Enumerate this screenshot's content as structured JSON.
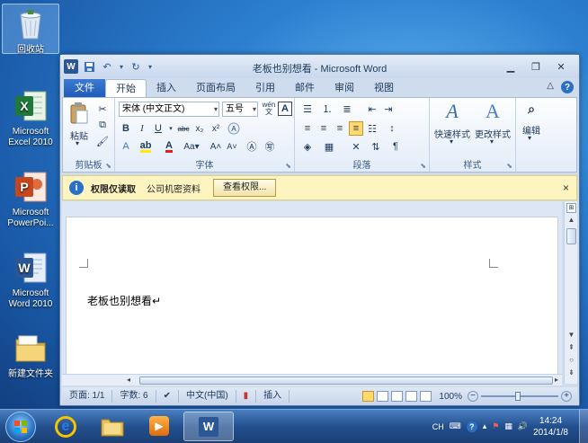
{
  "desktop": {
    "icons": [
      {
        "label": "回收站",
        "icon": "recycle-bin-icon"
      },
      {
        "label": "Microsoft Excel 2010",
        "icon": "excel-icon"
      },
      {
        "label": "Microsoft PowerPoi...",
        "icon": "powerpoint-icon"
      },
      {
        "label": "Microsoft Word 2010",
        "icon": "word-icon"
      },
      {
        "label": "新建文件夹",
        "icon": "folder-icon"
      }
    ]
  },
  "window": {
    "title": "老板也别想看 - Microsoft Word",
    "qat": {
      "logo": "W"
    },
    "tabs": [
      "文件",
      "开始",
      "插入",
      "页面布局",
      "引用",
      "邮件",
      "审阅",
      "视图"
    ],
    "active_tab": "开始",
    "ribbon": {
      "clipboard": {
        "paste_label": "粘贴",
        "group_label": "剪贴板"
      },
      "font": {
        "font_name": "宋体 (中文正文)",
        "font_size": "五号",
        "group_label": "字体",
        "wen": "wén",
        "wen_char": "文"
      },
      "paragraph": {
        "group_label": "段落"
      },
      "styles": {
        "quick_styles": "快速样式",
        "change_styles": "更改样式",
        "group_label": "样式"
      },
      "editing": {
        "label": "编辑"
      }
    },
    "message_bar": {
      "title": "权限仅读取",
      "text": "公司机密资料",
      "button": "查看权限...",
      "close": "×"
    },
    "document": {
      "text": "老板也别想看↵"
    },
    "status": {
      "page": "页面: 1/1",
      "words": "字数: 6",
      "language": "中文(中国)",
      "mode": "插入",
      "zoom": "100%"
    }
  },
  "taskbar": {
    "tray": {
      "lang": "CH",
      "time": "14:24",
      "date": "2014/1/8"
    }
  }
}
